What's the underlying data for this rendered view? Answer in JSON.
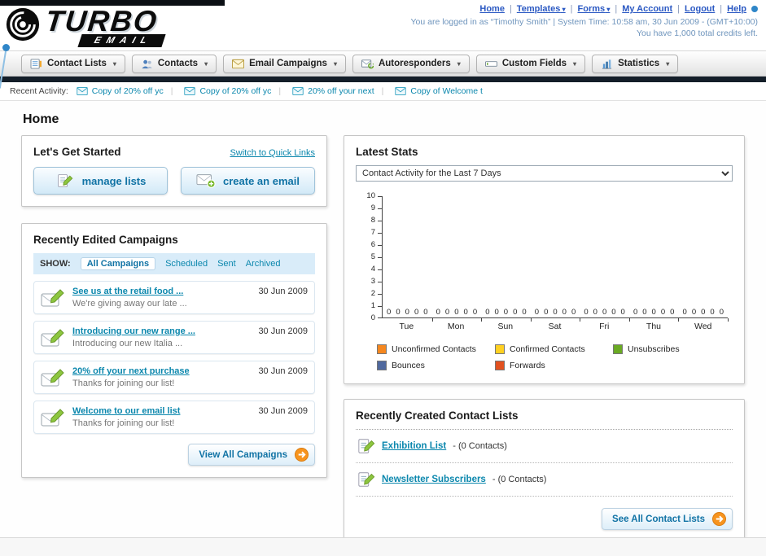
{
  "page_title": "Home",
  "theme": {
    "link_teal": "#0b87ad",
    "header_link_blue": "#2b59c3",
    "dark_bar": "#141e29",
    "button_text_blue": "#1173a5",
    "go_arrow_orange": "#f7941e"
  },
  "header": {
    "logo": {
      "line1": "TURBO",
      "line2": "EMAIL"
    },
    "links": [
      {
        "label": "Home"
      },
      {
        "label": "Templates"
      },
      {
        "label": "Forms"
      },
      {
        "label": "My Account"
      },
      {
        "label": "Logout"
      },
      {
        "label": "Help"
      }
    ],
    "login_info": "You are logged in as “Timothy Smith” | System Time: 10:58 am, 30 Jun 2009 - (GMT+10:00)",
    "credits_info": "You have 1,000 total credits left."
  },
  "nav": {
    "items": [
      {
        "label": "Contact Lists"
      },
      {
        "label": "Contacts"
      },
      {
        "label": "Email Campaigns"
      },
      {
        "label": "Autoresponders"
      },
      {
        "label": "Custom Fields"
      },
      {
        "label": "Statistics"
      }
    ]
  },
  "recent_activity": {
    "label": "Recent Activity:",
    "items": [
      "Copy of 20% off yc",
      "Copy of 20% off yc",
      "20% off your next",
      "Copy of Welcome t"
    ]
  },
  "get_started": {
    "title": "Let's Get Started",
    "switch_link": "Switch to Quick Links",
    "manage_lists_label": "manage lists",
    "create_email_label": "create an email"
  },
  "campaigns": {
    "title": "Recently Edited Campaigns",
    "show_label": "SHOW:",
    "filters": [
      "All Campaigns",
      "Scheduled",
      "Sent",
      "Archived"
    ],
    "items": [
      {
        "title": "See us at the retail food ...",
        "subtitle": "We're giving away our late ...",
        "date": "30 Jun 2009"
      },
      {
        "title": "Introducing our new range ...",
        "subtitle": "Introducing our new Italia ...",
        "date": "30 Jun 2009"
      },
      {
        "title": "20% off your next purchase",
        "subtitle": "Thanks for joining our list!",
        "date": "30 Jun 2009"
      },
      {
        "title": "Welcome to our email list",
        "subtitle": "Thanks for joining our list!",
        "date": "30 Jun 2009"
      }
    ],
    "view_all_label": "View All Campaigns"
  },
  "stats": {
    "title": "Latest Stats",
    "dropdown_value": "Contact Activity for the Last 7 Days",
    "chart_data": {
      "type": "bar",
      "title": "Contact Activity for the Last 7 Days",
      "categories": [
        "Tue",
        "Mon",
        "Sun",
        "Sat",
        "Fri",
        "Thu",
        "Wed"
      ],
      "series": [
        {
          "name": "Unconfirmed Contacts",
          "color": "#f5871f",
          "values": [
            0,
            0,
            0,
            0,
            0,
            0,
            0
          ]
        },
        {
          "name": "Confirmed Contacts",
          "color": "#ffd021",
          "values": [
            0,
            0,
            0,
            0,
            0,
            0,
            0
          ]
        },
        {
          "name": "Unsubscribes",
          "color": "#6aaa23",
          "values": [
            0,
            0,
            0,
            0,
            0,
            0,
            0
          ]
        },
        {
          "name": "Bounces",
          "color": "#50699e",
          "values": [
            0,
            0,
            0,
            0,
            0,
            0,
            0
          ]
        },
        {
          "name": "Forwards",
          "color": "#e2511f",
          "values": [
            0,
            0,
            0,
            0,
            0,
            0,
            0
          ]
        }
      ],
      "ylim": [
        0,
        10
      ],
      "yticks": [
        0,
        1,
        2,
        3,
        4,
        5,
        6,
        7,
        8,
        9,
        10
      ],
      "grid": false,
      "legend_position": "bottom"
    }
  },
  "contact_lists": {
    "title": "Recently Created Contact Lists",
    "items": [
      {
        "name": "Exhibition List",
        "details": "- (0 Contacts)"
      },
      {
        "name": "Newsletter Subscribers",
        "details": "- (0 Contacts)"
      }
    ],
    "see_all_label": "See All Contact Lists"
  }
}
